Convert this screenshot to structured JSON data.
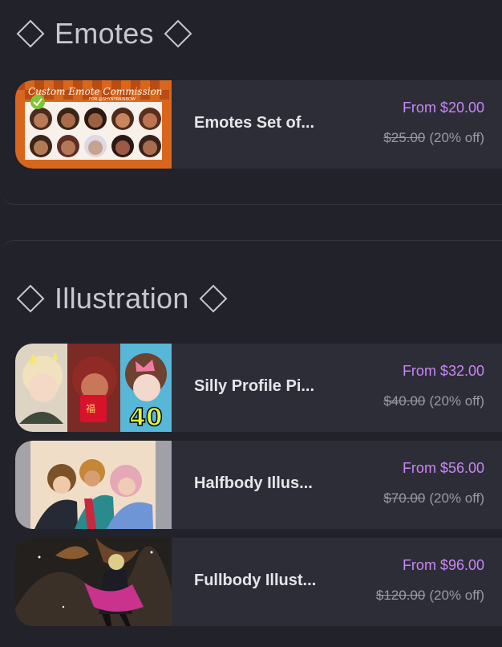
{
  "sections": [
    {
      "title": "Emotes",
      "items": [
        {
          "title": "Emotes Set of...",
          "from_price": "From $20.00",
          "original_price": "$25.00",
          "discount": "(20% off)",
          "thumb_caption": "Custom Emote Commission",
          "thumb_subcaption": "FOR @SHYNYRAINBOW"
        }
      ]
    },
    {
      "title": "Illustration",
      "items": [
        {
          "title": "Silly Profile Pi...",
          "from_price": "From $32.00",
          "original_price": "$40.00",
          "discount": "(20% off)",
          "thumb_text": "40"
        },
        {
          "title": "Halfbody Illus...",
          "from_price": "From $56.00",
          "original_price": "$70.00",
          "discount": "(20% off)"
        },
        {
          "title": "Fullbody Illust...",
          "from_price": "From $96.00",
          "original_price": "$120.00",
          "discount": "(20% off)"
        }
      ]
    }
  ],
  "colors": {
    "background": "#22222b",
    "card": "#2d2d37",
    "accent_price": "#c887f4",
    "muted_text": "#9a9aa3",
    "heading_text": "#c8c8d0"
  },
  "icons": {
    "heading_left": "diamond-outline-icon",
    "heading_right": "diamond-outline-icon",
    "check": "check-badge-icon"
  }
}
